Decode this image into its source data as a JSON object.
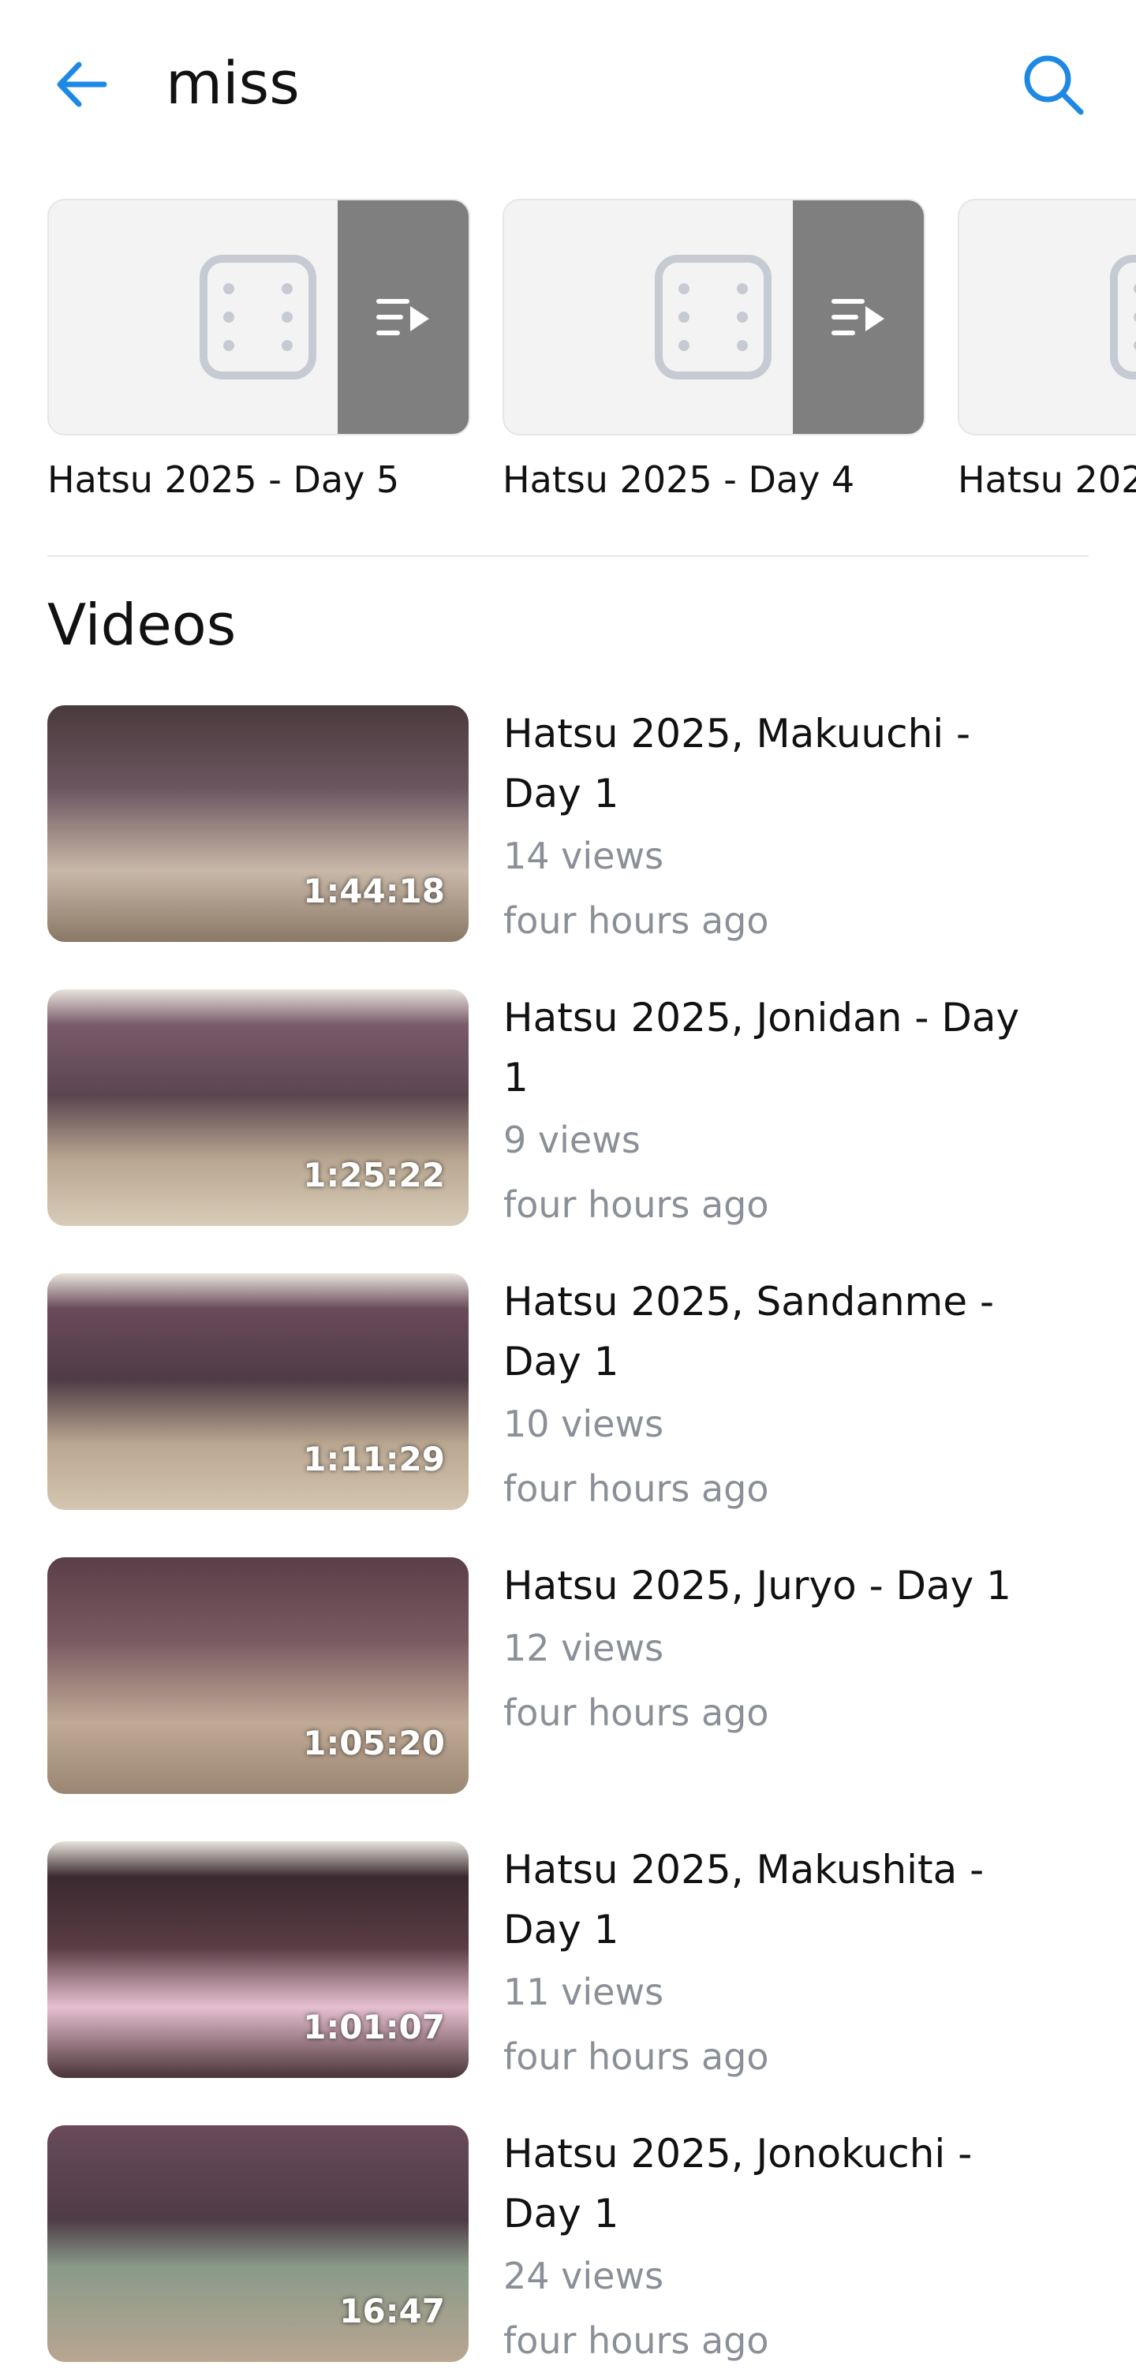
{
  "header": {
    "query": "miss",
    "back_icon": "arrow-back-icon",
    "search_icon": "search-icon",
    "accent_color": "#1e88e5"
  },
  "playlists": [
    {
      "title": "Hatsu 2025 - Day 5"
    },
    {
      "title": "Hatsu 2025 - Day 4"
    },
    {
      "title": "Hatsu 202"
    }
  ],
  "videos_section": {
    "title": "Videos"
  },
  "videos": [
    {
      "title": "Hatsu 2025, Makuuchi - Day 1",
      "views": "14 views",
      "date": "four hours ago",
      "duration": "1:44:18"
    },
    {
      "title": "Hatsu 2025, Jonidan - Day 1",
      "views": "9 views",
      "date": "four hours ago",
      "duration": "1:25:22"
    },
    {
      "title": "Hatsu 2025, Sandanme - Day 1",
      "views": "10 views",
      "date": "four hours ago",
      "duration": "1:11:29"
    },
    {
      "title": "Hatsu 2025, Juryo - Day 1",
      "views": "12 views",
      "date": "four hours ago",
      "duration": "1:05:20"
    },
    {
      "title": "Hatsu 2025, Makushita - Day 1",
      "views": "11 views",
      "date": "four hours ago",
      "duration": "1:01:07"
    },
    {
      "title": "Hatsu 2025, Jonokuchi - Day 1",
      "views": "24 views",
      "date": "four hours ago",
      "duration": "16:47"
    }
  ]
}
